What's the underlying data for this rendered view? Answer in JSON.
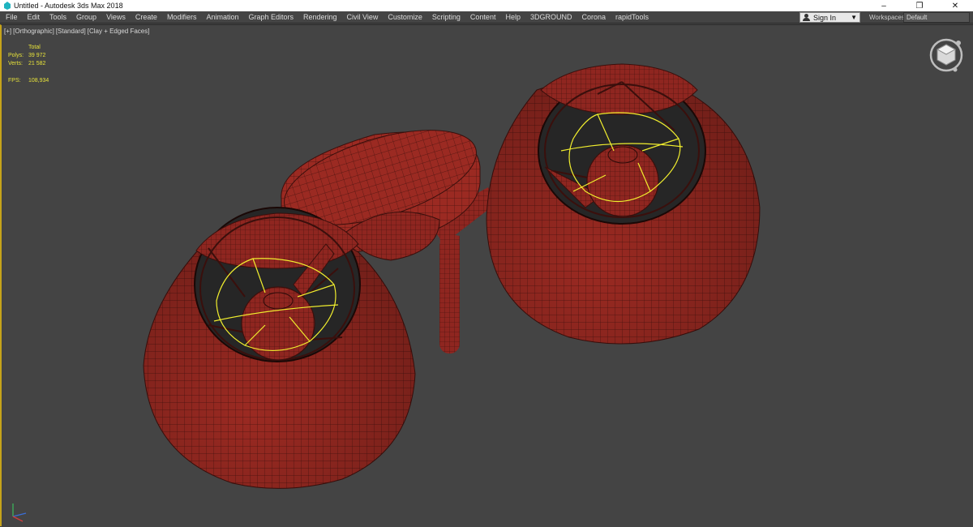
{
  "titlebar": {
    "title": "Untitled - Autodesk 3ds Max 2018",
    "minimize": "–",
    "restore": "❐",
    "close": "✕"
  },
  "menubar": {
    "items": [
      "File",
      "Edit",
      "Tools",
      "Group",
      "Views",
      "Create",
      "Modifiers",
      "Animation",
      "Graph Editors",
      "Rendering",
      "Civil View",
      "Customize",
      "Scripting",
      "Content",
      "Help",
      "3DGROUND",
      "Corona",
      "rapidTools"
    ],
    "sign_in": "Sign In",
    "workspaces_label": "Workspaces:",
    "workspace_value": "Default"
  },
  "viewport": {
    "labels": [
      "[+]",
      "[Orthographic]",
      "[Standard]",
      "[Clay + Edged Faces]"
    ],
    "stats": {
      "header": "Total",
      "polys_label": "Polys:",
      "polys_value": "39 972",
      "verts_label": "Verts:",
      "verts_value": "21 582",
      "fps_label": "FPS:",
      "fps_value": "108,934"
    }
  },
  "colors": {
    "viewport_bg": "#444444",
    "model_clay": "#9b2a22",
    "wire": "#3a0f0c",
    "light_wire": "#f1ee2e",
    "stats_text": "#e6e23a",
    "active_border": "#c6a31a"
  },
  "icons": [
    "app-icon",
    "user-icon",
    "chevron-down-icon",
    "viewcube-icon",
    "axis-tripod-icon"
  ]
}
